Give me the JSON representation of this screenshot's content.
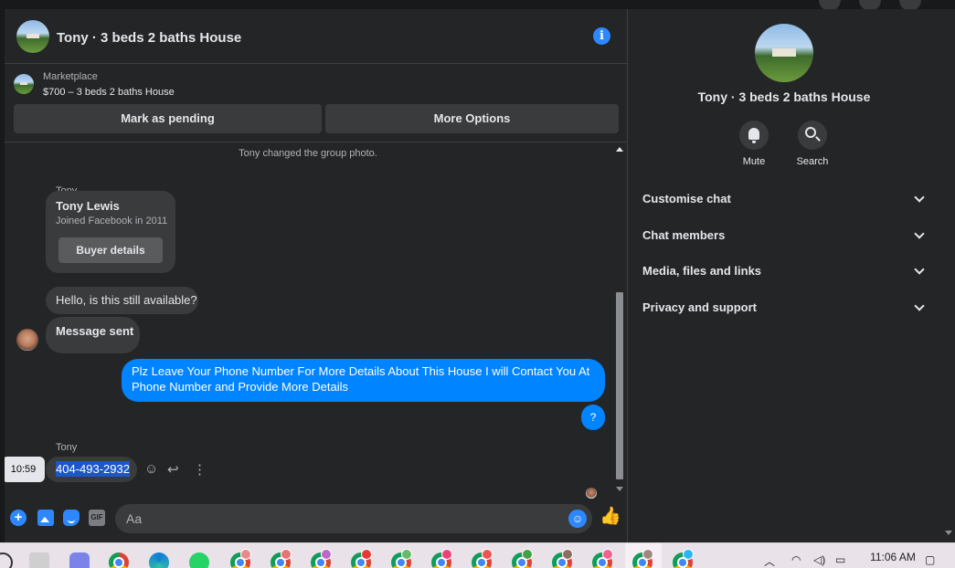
{
  "chat": {
    "title": "Tony · 3 beds 2 baths House",
    "info_icon": "i"
  },
  "marketplace": {
    "label": "Marketplace",
    "item": "$700 – 3 beds 2 baths House",
    "mark_pending_label": "Mark as pending",
    "more_options_label": "More Options"
  },
  "messages": {
    "system_note": "Tony changed the group photo.",
    "sender_name_1": "Tony",
    "buyer_card": {
      "name": "Tony Lewis",
      "subtitle": "Joined Facebook in 2011",
      "button_label": "Buyer details"
    },
    "hello": "Hello, is this still available?",
    "message_sent": "Message sent",
    "outgoing_long": "Plz Leave Your Phone Number For More Details About This House I will Contact You At Phone Number and Provide More Details",
    "outgoing_q": "?",
    "sender_name_2": "Tony",
    "phone": "404-493-2932",
    "time_tooltip": "10:59",
    "action_icons": {
      "react": "☺",
      "reply": "↩",
      "more": "⋮"
    }
  },
  "composer": {
    "placeholder": "Aa",
    "plus": "+",
    "gif": "GIF",
    "emoji": "☺",
    "like": "👍"
  },
  "info_panel": {
    "title": "Tony · 3 beds 2 baths House",
    "mute_label": "Mute",
    "search_label": "Search",
    "sections": [
      "Customise chat",
      "Chat members",
      "Media, files and links",
      "Privacy and support"
    ]
  },
  "taskbar": {
    "time": "11:06 AM",
    "tray_icons": [
      "chevron-up-icon",
      "wifi-icon",
      "volume-icon",
      "battery-icon"
    ]
  },
  "colors": {
    "accent": "#0084ff",
    "background": "#242526",
    "bubble_incoming": "#3a3b3c"
  }
}
